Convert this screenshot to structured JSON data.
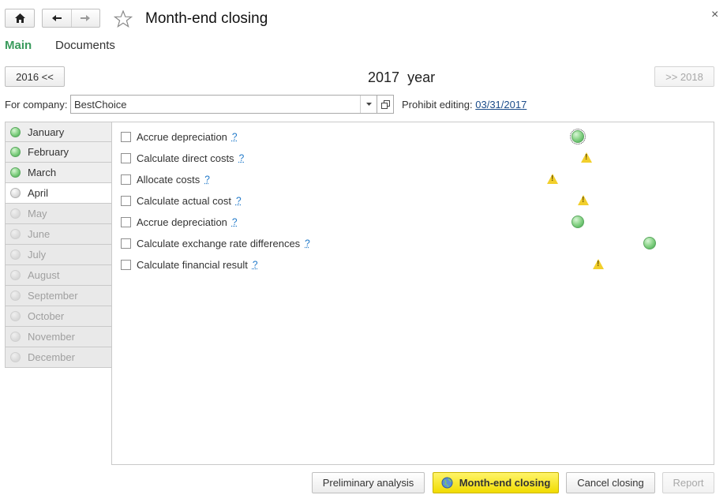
{
  "header": {
    "title": "Month-end closing",
    "close_glyph": "×"
  },
  "tabs": [
    {
      "label": "Main",
      "active": true
    },
    {
      "label": "Documents",
      "active": false
    }
  ],
  "year_nav": {
    "prev_label": "2016 <<",
    "current_year": "2017",
    "year_word": "year",
    "next_label": ">> 2018"
  },
  "company": {
    "label": "For company:",
    "value": "BestChoice",
    "prohibit_label": "Prohibit editing:",
    "prohibit_date": "03/31/2017"
  },
  "months": [
    {
      "name": "January",
      "state": "done"
    },
    {
      "name": "February",
      "state": "done"
    },
    {
      "name": "March",
      "state": "done"
    },
    {
      "name": "April",
      "state": "current"
    },
    {
      "name": "May",
      "state": "future"
    },
    {
      "name": "June",
      "state": "future"
    },
    {
      "name": "July",
      "state": "future"
    },
    {
      "name": "August",
      "state": "future"
    },
    {
      "name": "September",
      "state": "future"
    },
    {
      "name": "October",
      "state": "future"
    },
    {
      "name": "November",
      "state": "future"
    },
    {
      "name": "December",
      "state": "future"
    }
  ],
  "tasks": [
    {
      "label": "Accrue depreciation",
      "help": "?",
      "status": "ok"
    },
    {
      "label": "Calculate direct costs",
      "help": "?",
      "status": "warning"
    },
    {
      "label": "Allocate costs",
      "help": "?",
      "status": "warning"
    },
    {
      "label": "Calculate actual cost",
      "help": "?",
      "status": "warning"
    },
    {
      "label": "Accrue depreciation",
      "help": "?",
      "status": "ok"
    },
    {
      "label": "Calculate exchange rate differences",
      "help": "?",
      "status": "ok"
    },
    {
      "label": "Calculate financial result",
      "help": "?",
      "status": "warning"
    }
  ],
  "footer": {
    "preliminary_label": "Preliminary analysis",
    "closing_label": "Month-end closing",
    "cancel_label": "Cancel closing",
    "report_label": "Report"
  }
}
